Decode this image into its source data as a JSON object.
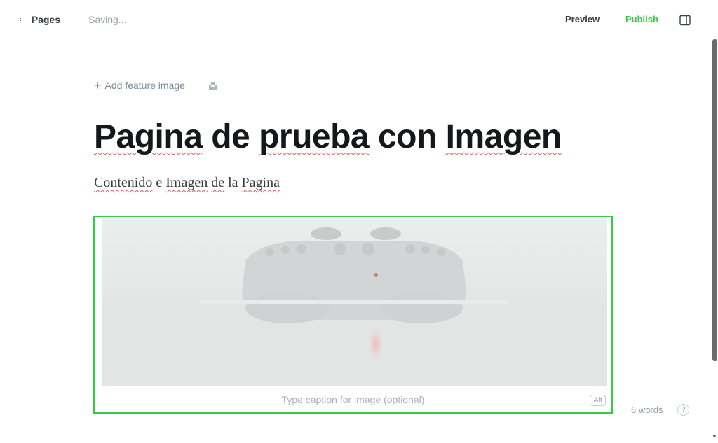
{
  "header": {
    "back_label": "Pages",
    "status": "Saving...",
    "preview_label": "Preview",
    "publish_label": "Publish",
    "accent_color": "#30cf43"
  },
  "editor": {
    "add_feature_label": "Add feature image",
    "title_words": [
      "Pagina",
      "de",
      "prueba",
      "con",
      "Imagen"
    ],
    "body_words": [
      "Contenido",
      "e",
      "Imagen",
      "de",
      "la",
      "Pagina"
    ],
    "image": {
      "subject": "game controller",
      "caption_placeholder": "Type caption for image (optional)",
      "alt_label": "Alt"
    }
  },
  "footer": {
    "word_count": "6 words",
    "help_label": "?"
  },
  "icons": [
    "chevron-left-icon",
    "sidebar-toggle-icon",
    "unsplash-icon",
    "help-icon"
  ]
}
